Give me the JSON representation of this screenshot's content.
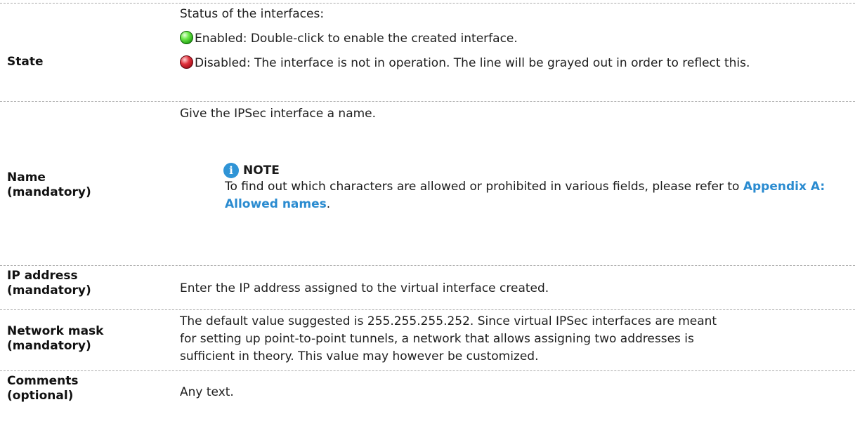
{
  "rows": {
    "state": {
      "label": "State",
      "intro": "Status of the interfaces:",
      "enabled_text": "Enabled: Double-click to enable the created interface.",
      "disabled_text": "Disabled: The interface is not in operation. The line will be grayed out in order to reflect this.",
      "enabled_icon": "green-status-icon",
      "disabled_icon": "red-status-icon"
    },
    "name": {
      "label_line1": "Name",
      "label_line2": "(mandatory)",
      "description": "Give the IPSec interface a name.",
      "note_icon": "info-icon",
      "note_title": "NOTE",
      "note_text": "To find out which characters are allowed or prohibited in various fields, please refer to",
      "note_link": "Appendix A: Allowed names",
      "note_end": "."
    },
    "ip": {
      "label_line1": "IP address",
      "label_line2": "(mandatory)",
      "description": "Enter the IP address assigned to the virtual interface created."
    },
    "mask": {
      "label_line1": "Network mask",
      "label_line2": "(mandatory)",
      "description": "The default value suggested is 255.255.255.252. Since virtual IPSec interfaces are meant for setting up point-to-point tunnels, a network that allows assigning two addresses is sufficient in theory. This value may however be customized."
    },
    "comments": {
      "label_line1": "Comments",
      "label_line2": "(optional)",
      "description": "Any text."
    }
  },
  "colors": {
    "link": "#2a8bd0",
    "separator": "#a9a9a9",
    "info_icon": "#2f94d6"
  }
}
